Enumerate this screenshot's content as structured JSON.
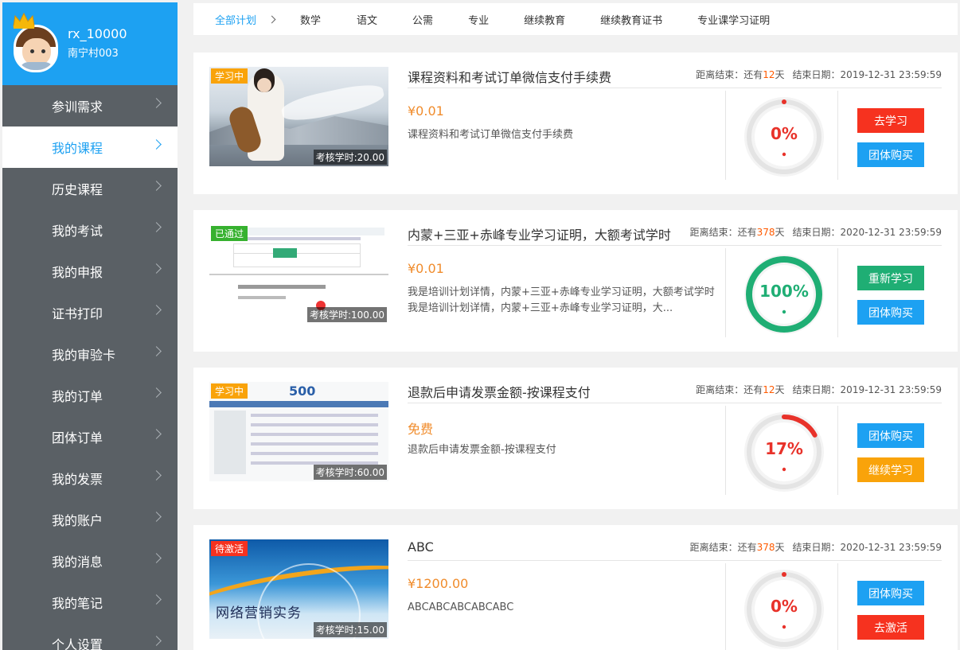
{
  "user": {
    "name": "rx_10000",
    "org": "南宁村003"
  },
  "menu": [
    {
      "label": "参训需求"
    },
    {
      "label": "我的课程"
    },
    {
      "label": "历史课程"
    },
    {
      "label": "我的考试"
    },
    {
      "label": "我的申报"
    },
    {
      "label": "证书打印"
    },
    {
      "label": "我的审验卡"
    },
    {
      "label": "我的订单"
    },
    {
      "label": "团体订单"
    },
    {
      "label": "我的发票"
    },
    {
      "label": "我的账户"
    },
    {
      "label": "我的消息"
    },
    {
      "label": "我的笔记"
    },
    {
      "label": "个人设置"
    }
  ],
  "active_menu": "我的课程",
  "topnav": [
    "全部计划",
    "数学",
    "语文",
    "公需",
    "专业",
    "继续教育",
    "继续教育证书",
    "专业课学习证明"
  ],
  "colors": {
    "accent": "#1da1f2",
    "red": "#f6321f",
    "green": "#1fae74",
    "orange": "#f9a30a",
    "price": "#f08c2c"
  },
  "labels": {
    "remain_prefix": "距离结束：还有",
    "remain_suffix": "天",
    "end_prefix": "结束日期："
  },
  "courses": [
    {
      "badge": "学习中",
      "hours": "考核学时:20.00",
      "title": "课程资料和考试订单微信支付手续费",
      "days": "12",
      "end_date": "2019-12-31 23:59:59",
      "price": "¥0.01",
      "desc": "课程资料和考试订单微信支付手续费",
      "progress_text": "0%",
      "progress": 0,
      "buttons": [
        "去学习",
        "团体购买"
      ]
    },
    {
      "badge": "已通过",
      "hours": "考核学时:100.00",
      "title": "内蒙+三亚+赤峰专业学习证明，大额考试学时",
      "days": "378",
      "end_date": "2020-12-31 23:59:59",
      "price": "¥0.01",
      "desc": "我是培训计划详情，内蒙+三亚+赤峰专业学习证明，大额考试学时我是培训计划详情，内蒙+三亚+赤峰专业学习证明，大...",
      "progress_text": "100%",
      "progress": 100,
      "buttons": [
        "重新学习",
        "团体购买"
      ]
    },
    {
      "badge": "学习中",
      "hours": "考核学时:60.00",
      "title": "退款后申请发票金额-按课程支付",
      "days": "12",
      "end_date": "2019-12-31 23:59:59",
      "price": "免费",
      "desc": "退款后申请发票金额-按课程支付",
      "progress_text": "17%",
      "progress": 17,
      "buttons": [
        "团体购买",
        "继续学习"
      ],
      "thumb_text": "500"
    },
    {
      "badge": "待激活",
      "hours": "考核学时:15.00",
      "title": "ABC",
      "days": "378",
      "end_date": "2020-12-31 23:59:59",
      "price": "¥1200.00",
      "desc": "ABCABCABCABCABC",
      "progress_text": "0%",
      "progress": 0,
      "buttons": [
        "团体购买",
        "去激活"
      ],
      "thumb_text": "网络营销实务"
    }
  ]
}
